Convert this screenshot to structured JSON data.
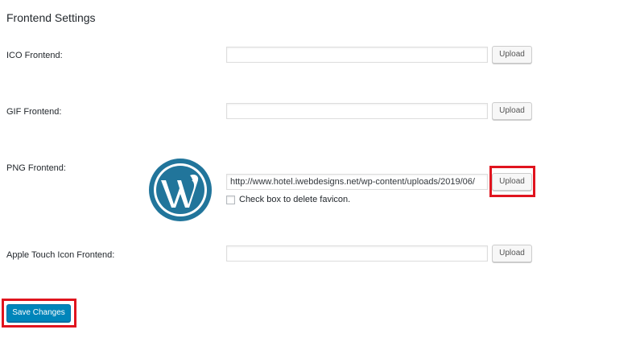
{
  "section": {
    "title": "Frontend Settings"
  },
  "rows": [
    {
      "label": "ICO Frontend:",
      "value": "",
      "button": "Upload"
    },
    {
      "label": "GIF Frontend:",
      "value": "",
      "button": "Upload"
    },
    {
      "label": "PNG Frontend:",
      "value": "http://www.hotel.iwebdesigns.net/wp-content/uploads/2019/06/",
      "button": "Upload",
      "checkbox_label": "Check box to delete favicon.",
      "checkbox_checked": false,
      "preview_icon": "wordpress-logo-icon"
    },
    {
      "label": "Apple Touch Icon Frontend:",
      "value": "",
      "button": "Upload"
    }
  ],
  "actions": {
    "save_label": "Save Changes"
  },
  "colors": {
    "primary": "#0085ba",
    "highlight": "#e0141e",
    "wordpress_blue": "#21759b"
  }
}
